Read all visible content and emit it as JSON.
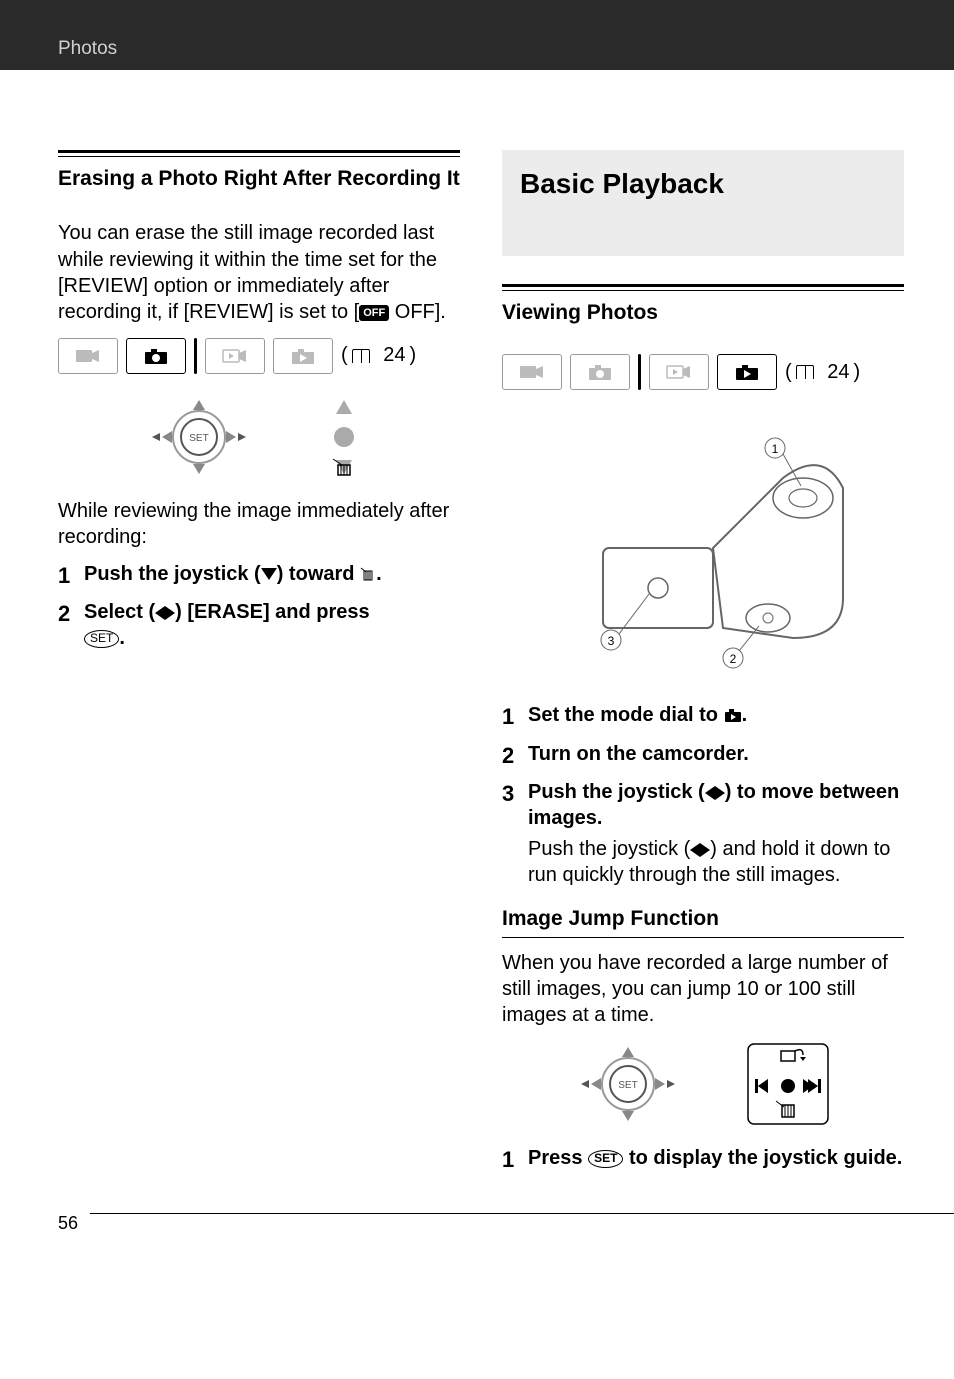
{
  "header": {
    "breadcrumb": "Photos"
  },
  "left": {
    "section_title": "Erasing a Photo Right After Recording It",
    "intro": "You can erase the still image recorded last while reviewing it within the time set for the [REVIEW] option or immediately after recording it, if [REVIEW] is set to [",
    "intro_end": " OFF].",
    "page_ref": "24",
    "review_text": "While reviewing the image immediately after recording:",
    "steps": [
      {
        "pre": "Push the joystick (",
        "post": ") toward  ",
        "trail": "."
      },
      {
        "pre": "Select (",
        "post": ") [ERASE] and press ",
        "trail": "."
      }
    ]
  },
  "right": {
    "main_heading": "Basic Playback",
    "section_title": "Viewing Photos",
    "page_ref": "24",
    "steps": [
      {
        "text_pre": "Set the mode dial to ",
        "text_post": "."
      },
      {
        "text": "Turn on the camcorder."
      },
      {
        "text_pre": "Push the joystick (",
        "text_post": ") to move between images.",
        "sub_pre": "Push the joystick (",
        "sub_post": ") and hold it down to run quickly through the still images."
      }
    ],
    "jump_title": "Image Jump Function",
    "jump_para": "When you have recorded a large number of still images, you can jump 10 or 100 still images at a time.",
    "jump_steps": [
      {
        "pre": "Press  ",
        "post": "  to display the joystick guide."
      }
    ]
  },
  "page_number": "56"
}
